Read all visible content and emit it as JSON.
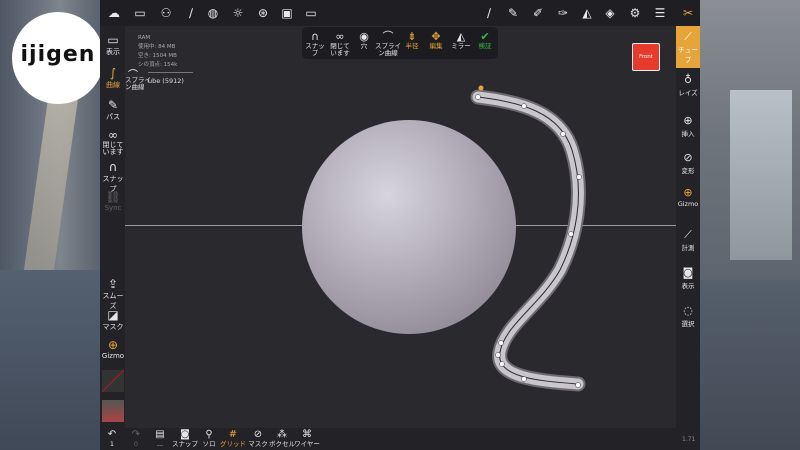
{
  "logo": {
    "text": "ijigen"
  },
  "top": {
    "icons": [
      "cloud-icon",
      "folder-icon",
      "share-icon",
      "brush-icon",
      "globe-icon",
      "sun-icon",
      "film-icon",
      "image-icon",
      "video-icon",
      "pen-icon",
      "pencil-icon",
      "marker-icon",
      "clay-icon",
      "triangle-icon",
      "layers-icon",
      "settings-icon",
      "sliders-icon",
      "tools-icon"
    ]
  },
  "stats": {
    "ram": "RAM",
    "used": "使用中: 84 MB",
    "free": "空き: 1504 MB",
    "verts": "シの頂点: 154k"
  },
  "left_labels": {
    "display": "表示",
    "curve": "曲線",
    "path": "パス",
    "closed": "閉じています",
    "snap": "スナップ",
    "sync": "Sync",
    "spline": "スプライン曲線",
    "tube": "ube (5912)",
    "smooth": "スムーズ",
    "mask": "マスク",
    "gizmo": "Gizmo"
  },
  "toolbar": {
    "items": [
      "スナップ",
      "閉じています",
      "穴",
      "スプライン曲線",
      "半径",
      "編集",
      "ミラー",
      "検証"
    ]
  },
  "front_button": "Front",
  "right_labels": {
    "tube": "チューブ",
    "layers": "レイズ",
    "insert": "挿入",
    "deform": "変形",
    "gizmo": "Gizmo",
    "measure": "計測",
    "display": "表示",
    "select": "選択"
  },
  "bottom": {
    "undo_count": "1",
    "redo_count": "0",
    "labels": [
      "...",
      "スナップ",
      "ソロ",
      "グリッド",
      "マスク",
      "ボクセル",
      "ワイヤー"
    ],
    "version": "1.71"
  },
  "colors": {
    "accent": "#e5a53b",
    "front": "#e53a2c",
    "verify": "#39b54a"
  }
}
